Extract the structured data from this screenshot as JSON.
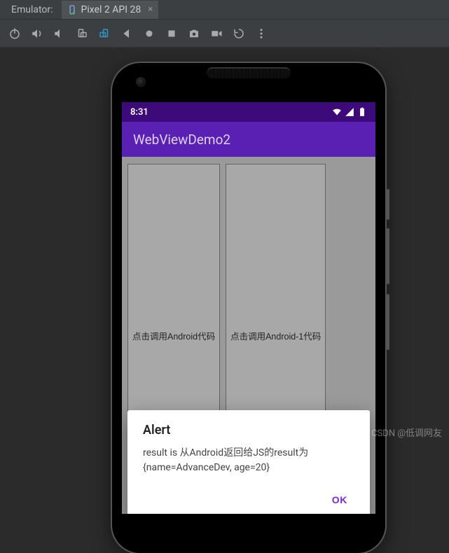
{
  "tabbar": {
    "emulator_label": "Emulator:",
    "tab_name": "Pixel 2 API 28"
  },
  "toolbar": {
    "icons": [
      "power-icon",
      "volume-up-icon",
      "volume-down-icon",
      "rotate-left-icon",
      "rotate-right-icon",
      "back-icon",
      "home-icon",
      "overview-icon",
      "screenshot-icon",
      "record-icon",
      "restore-icon",
      "more-icon"
    ]
  },
  "statusbar": {
    "time": "8:31"
  },
  "appbar": {
    "title": "WebViewDemo2"
  },
  "buttons": {
    "btn1": "点击调用Android代码",
    "btn2": "点击调用Android-1代码"
  },
  "dialog": {
    "title": "Alert",
    "message": "result is 从Android返回给JS的result为{name=AdvanceDev, age=20}",
    "ok": "OK"
  },
  "watermark": "CSDN @低调网友"
}
